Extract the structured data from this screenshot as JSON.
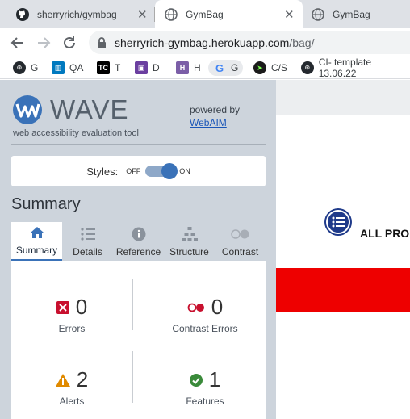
{
  "browser": {
    "tabs": [
      {
        "title": "sherryrich/gymbag",
        "favicon": "github-icon"
      },
      {
        "title": "GymBag",
        "favicon": "globe-icon",
        "active": true
      },
      {
        "title": "GymBag",
        "favicon": "globe-icon"
      }
    ],
    "url_host": "sherryrich-gymbag.herokuapp.com",
    "url_path": "/bag/",
    "bookmarks": [
      {
        "label": "G",
        "icon": "github-icon",
        "color": "#24292e"
      },
      {
        "label": "QA",
        "icon": "trello-icon",
        "color": "#0079bf"
      },
      {
        "label": "T",
        "icon": "tc-icon",
        "color": "#000000"
      },
      {
        "label": "D",
        "icon": "d-icon",
        "color": "#6b3fa0"
      },
      {
        "label": "H",
        "icon": "h-icon",
        "color": "#7b5ea7"
      },
      {
        "label": "G",
        "icon": "google-icon",
        "color": "#4285f4"
      },
      {
        "label": "C/S",
        "icon": "cs-icon",
        "color": "#1b1b1b"
      },
      {
        "label": "CI- template 13.06.22",
        "icon": "github-icon",
        "color": "#24292e"
      }
    ]
  },
  "wave": {
    "logo_word": "WAVE",
    "tagline": "web accessibility evaluation tool",
    "powered_by": "powered by",
    "webaim_link": "WebAIM",
    "styles_label": "Styles:",
    "styles_off": "OFF",
    "styles_on": "ON",
    "summary_title": "Summary",
    "tabs": [
      {
        "label": "Summary",
        "icon": "home-icon",
        "active": true
      },
      {
        "label": "Details",
        "icon": "list-icon"
      },
      {
        "label": "Reference",
        "icon": "info-icon"
      },
      {
        "label": "Structure",
        "icon": "structure-icon"
      },
      {
        "label": "Contrast",
        "icon": "contrast-icon"
      }
    ],
    "stats": {
      "errors": {
        "value": "0",
        "label": "Errors",
        "color": "#c8102e"
      },
      "contrast_errors": {
        "value": "0",
        "label": "Contrast Errors",
        "color": "#c8102e"
      },
      "alerts": {
        "value": "2",
        "label": "Alerts",
        "color": "#e08a00"
      },
      "features": {
        "value": "1",
        "label": "Features",
        "color": "#3a8a3a"
      }
    }
  },
  "page": {
    "menu_text": "ALL PRO",
    "accent_red": "#ee0000"
  }
}
